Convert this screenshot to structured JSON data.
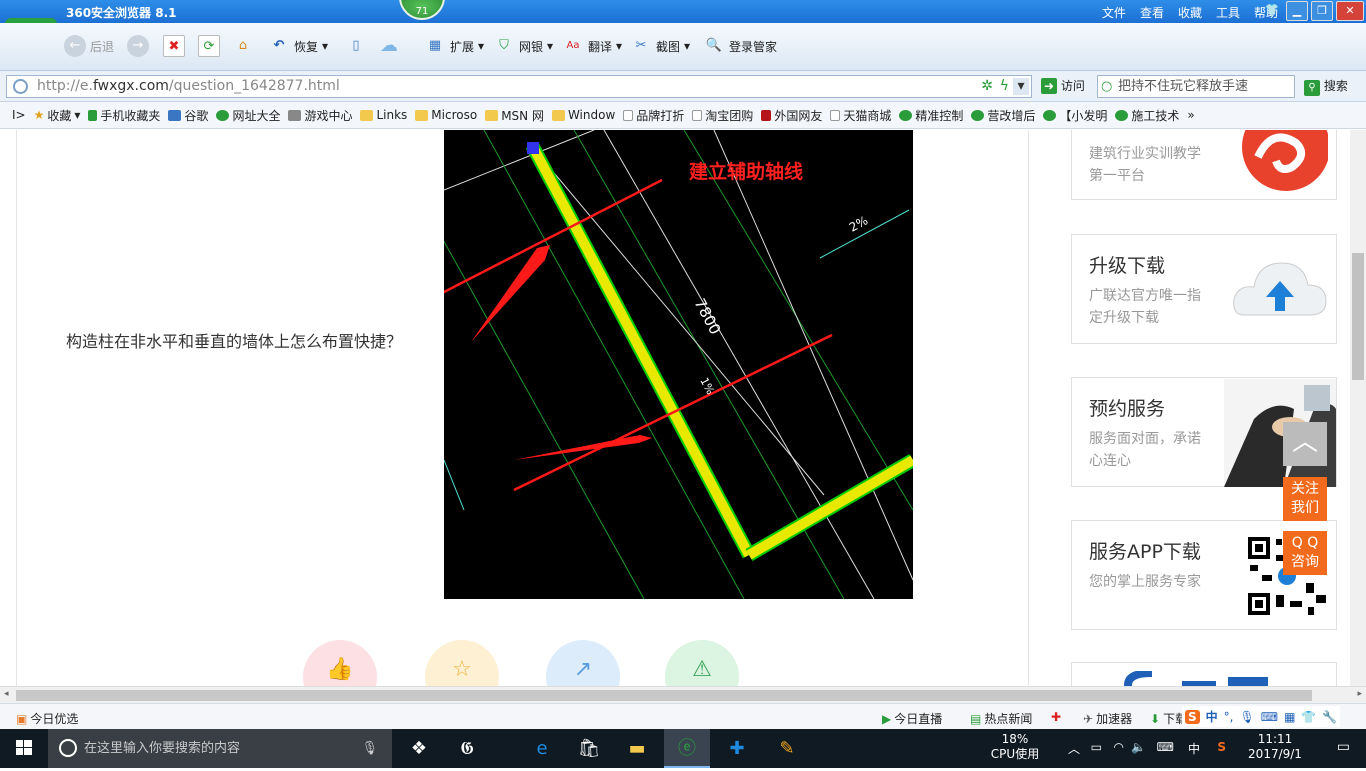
{
  "browser": {
    "title": "360安全浏览器 8.1",
    "badge": "71",
    "menu": [
      "文件",
      "查看",
      "收藏",
      "工具",
      "帮助"
    ],
    "toolbar": {
      "back": "后退",
      "restore": "恢复",
      "extend": "扩展",
      "bank": "网银",
      "translate": "翻译",
      "screenshot": "截图",
      "login": "登录管家"
    },
    "url_prefix": "http://e.",
    "url_domain": "fwxgx.com",
    "url_path": "/question_1642877.html",
    "visit": "访问",
    "search_placeholder": "把持不住玩它释放手速",
    "search_button": "搜索"
  },
  "favorites": [
    "收藏",
    "手机收藏夹",
    "谷歌",
    "网址大全",
    "游戏中心",
    "Links",
    "Microso",
    "MSN 网",
    "Window",
    "品牌打折",
    "淘宝团购",
    "外国网友",
    "天猫商城",
    "精准控制",
    "营改增后",
    "【小发明",
    "施工技术"
  ],
  "page": {
    "question": "构造柱在非水平和垂直的墙体上怎么布置快捷？",
    "cad": {
      "annotation": "建立辅助轴线",
      "dim": "7800",
      "slope1": "2%",
      "slope2": "1%"
    },
    "sidebar": [
      {
        "title": "",
        "sub": "建筑行业实训教学第一平台"
      },
      {
        "title": "升级下载",
        "sub": "广联达官方唯一指定升级下载"
      },
      {
        "title": "预约服务",
        "sub": "服务面对面，承诺心连心"
      },
      {
        "title": "服务APP下载",
        "sub": "您的掌上服务专家"
      }
    ],
    "float_follow": "关注我们",
    "float_qq": "Q Q 咨询"
  },
  "statusbar": {
    "left": "今日优选",
    "live": "今日直播",
    "news": "热点新闻",
    "speed": "加速器",
    "download": "下载"
  },
  "taskbar": {
    "search_placeholder": "在这里输入你要搜索的内容",
    "cpu_percent": "18%",
    "cpu_label": "CPU使用",
    "ime": "中",
    "time": "11:11",
    "date": "2017/9/1"
  }
}
